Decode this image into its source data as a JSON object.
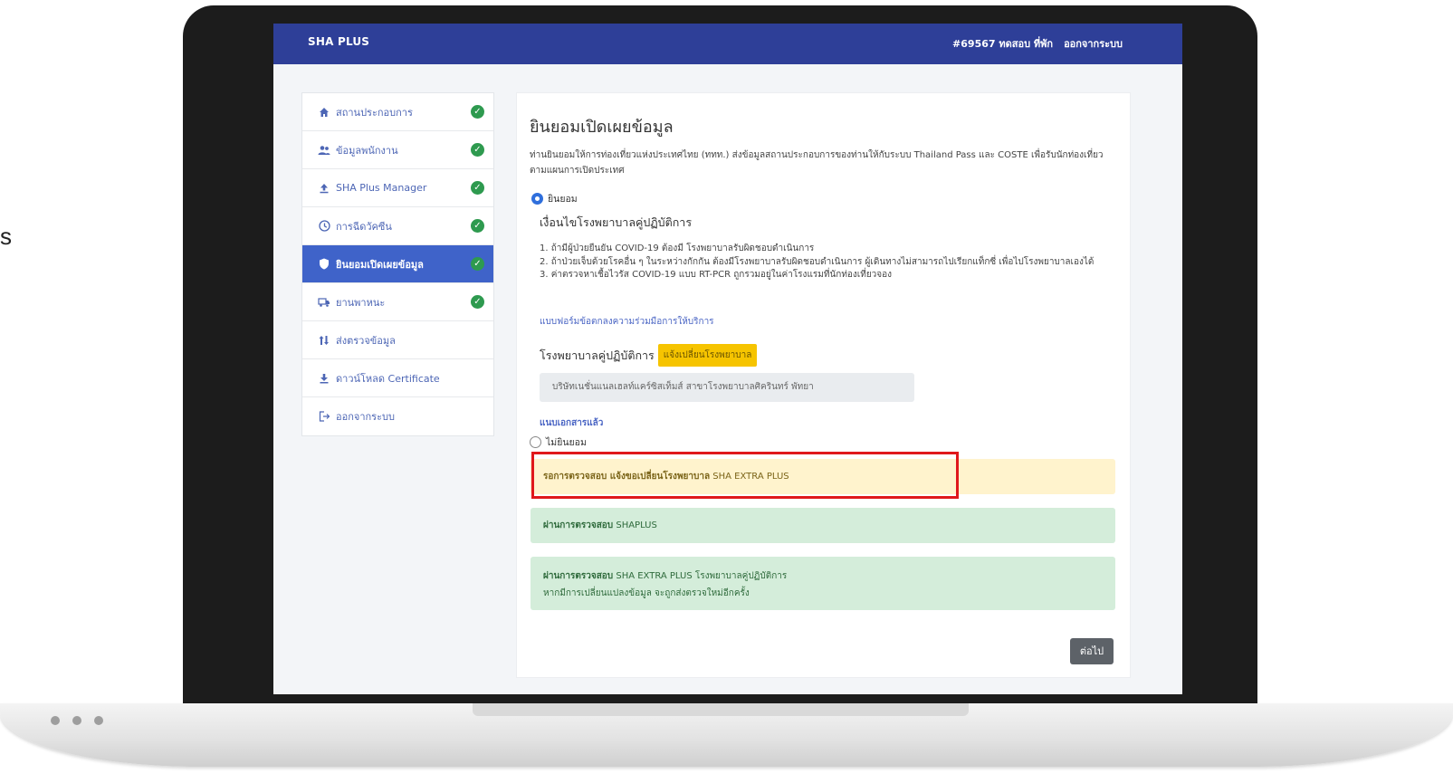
{
  "edge_text": "s",
  "header": {
    "brand": "SHA PLUS",
    "user": "#69567 ทดสอบ ที่พัก",
    "logout": "ออกจากระบบ"
  },
  "sidebar": {
    "items": [
      {
        "label": "สถานประกอบการ",
        "icon": "home-icon",
        "done": true,
        "active": false
      },
      {
        "label": "ข้อมูลพนักงาน",
        "icon": "users-icon",
        "done": true,
        "active": false
      },
      {
        "label": "SHA Plus Manager",
        "icon": "upload-icon",
        "done": true,
        "active": false
      },
      {
        "label": "การฉีดวัคซีน",
        "icon": "clock-icon",
        "done": true,
        "active": false
      },
      {
        "label": "ยินยอมเปิดเผยข้อมูล",
        "icon": "shield-icon",
        "done": true,
        "active": true
      },
      {
        "label": "ยานพาหนะ",
        "icon": "vehicle-icon",
        "done": true,
        "active": false
      },
      {
        "label": "ส่งตรวจข้อมูล",
        "icon": "sort-icon",
        "done": false,
        "active": false
      },
      {
        "label": "ดาวน์โหลด Certificate",
        "icon": "download-icon",
        "done": false,
        "active": false
      },
      {
        "label": "ออกจากระบบ",
        "icon": "logout-icon",
        "done": false,
        "active": false
      }
    ]
  },
  "main": {
    "title": "ยินยอมเปิดเผยข้อมูล",
    "intro": "ท่านยินยอมให้การท่องเที่ยวแห่งประเทศไทย (ททท.) ส่งข้อมูลสถานประกอบการของท่านให้กับระบบ Thailand Pass และ COSTE เพื่อรับนักท่องเที่ยวตามแผนการเปิดประเทศ",
    "consent_label": "ยินยอม",
    "conditions_title": "เงื่อนไขโรงพยาบาลคู่ปฏิบัติการ",
    "conditions": [
      "1. ถ้ามีผู้ป่วยยืนยัน COVID-19 ต้องมี โรงพยาบาลรับผิดชอบดำเนินการ",
      "2. ถ้าป่วยเจ็บด้วยโรคอื่น ๆ ในระหว่างกักกัน ต้องมีโรงพยาบาลรับผิดชอบดำเนินการ ผู้เดินทางไม่สามารถไปเรียกแท็กซี่ เพื่อไปโรงพยาบาลเองได้",
      "3. ค่าตรวจหาเชื้อไวรัส COVID-19 แบบ RT-PCR ถูกรวมอยู่ในค่าโรงแรมที่นักท่องเที่ยวจอง"
    ],
    "form_link": "แบบฟอร์มข้อตกลงความร่วมมือการให้บริการ",
    "hospital_label": "โรงพยาบาลคู่ปฏิบัติการ",
    "change_hospital_button": "แจ้งเปลี่ยนโรงพยาบาล",
    "hospital_value": "บริษัทเนชั่นแนลเฮลท์แคร์ซิสเท็มส์ สาขาโรงพยาบาลศิครินทร์ พัทยา",
    "attached_link": "แนบเอกสารแล้ว",
    "decline_label": "ไม่ยินยอม",
    "alert_pending_bold": "รอการตรวจสอบ แจ้งขอเปลี่ยนโรงพยาบาล",
    "alert_pending_text": "SHA EXTRA PLUS",
    "alert_pass1_bold": "ผ่านการตรวจสอบ",
    "alert_pass1_text": "SHAPLUS",
    "alert_pass2_bold": "ผ่านการตรวจสอบ",
    "alert_pass2_text": "SHA EXTRA PLUS โรงพยาบาลคู่ปฏิบัติการ",
    "alert_pass2_note": "หากมีการเปลี่ยนแปลงข้อมูล จะถูกส่งตรวจใหม่อีกครั้ง",
    "next_button": "ต่อไป"
  },
  "colors": {
    "navbar": "#2e3f98",
    "sidebar_active": "#3f63c9",
    "check": "#2e9a4f",
    "warning_bg": "#fff3cd",
    "success_bg": "#d4edda",
    "highlight": "#e0181c",
    "button_yellow": "#f6c400"
  }
}
